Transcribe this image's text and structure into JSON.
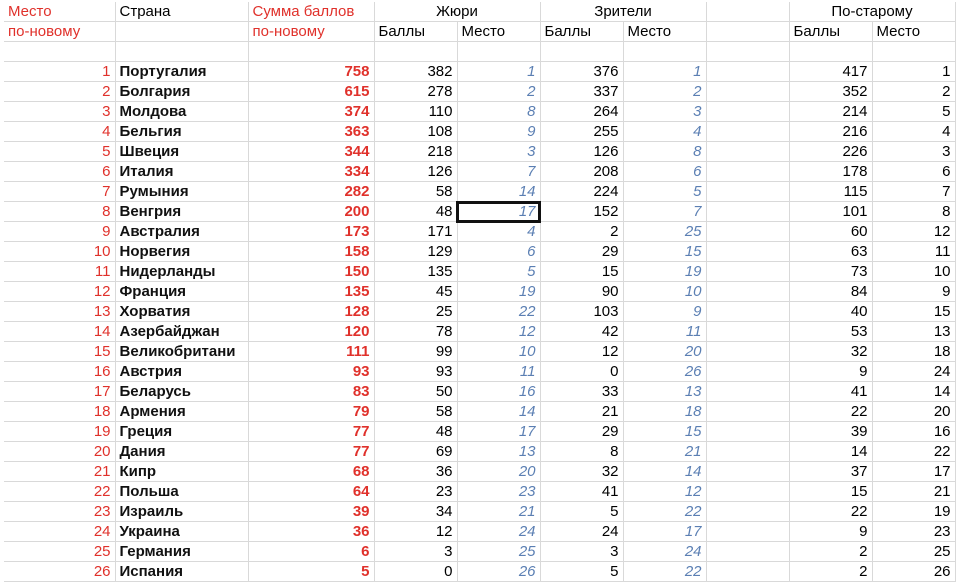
{
  "headers": {
    "row1": {
      "place_new": "Место",
      "country": "Страна",
      "sum": "Сумма баллов",
      "jury": "Жюри",
      "viewers": "Зрители",
      "old": "По-старому"
    },
    "row2": {
      "place_new": "по-новому",
      "sum": "по-новому",
      "jury_points": "Баллы",
      "jury_place": "Место",
      "viewers_points": "Баллы",
      "viewers_place": "Место",
      "old_points": "Баллы",
      "old_place": "Место"
    }
  },
  "rows": [
    {
      "place": "1",
      "country": "Португалия",
      "sum": "758",
      "jury_pts": "382",
      "jury_pl": "1",
      "view_pts": "376",
      "view_pl": "1",
      "old_pts": "417",
      "old_pl": "1"
    },
    {
      "place": "2",
      "country": "Болгария",
      "sum": "615",
      "jury_pts": "278",
      "jury_pl": "2",
      "view_pts": "337",
      "view_pl": "2",
      "old_pts": "352",
      "old_pl": "2"
    },
    {
      "place": "3",
      "country": "Молдова",
      "sum": "374",
      "jury_pts": "110",
      "jury_pl": "8",
      "view_pts": "264",
      "view_pl": "3",
      "old_pts": "214",
      "old_pl": "5"
    },
    {
      "place": "4",
      "country": "Бельгия",
      "sum": "363",
      "jury_pts": "108",
      "jury_pl": "9",
      "view_pts": "255",
      "view_pl": "4",
      "old_pts": "216",
      "old_pl": "4"
    },
    {
      "place": "5",
      "country": "Швеция",
      "sum": "344",
      "jury_pts": "218",
      "jury_pl": "3",
      "view_pts": "126",
      "view_pl": "8",
      "old_pts": "226",
      "old_pl": "3"
    },
    {
      "place": "6",
      "country": "Италия",
      "sum": "334",
      "jury_pts": "126",
      "jury_pl": "7",
      "view_pts": "208",
      "view_pl": "6",
      "old_pts": "178",
      "old_pl": "6"
    },
    {
      "place": "7",
      "country": "Румыния",
      "sum": "282",
      "jury_pts": "58",
      "jury_pl": "14",
      "view_pts": "224",
      "view_pl": "5",
      "old_pts": "115",
      "old_pl": "7"
    },
    {
      "place": "8",
      "country": "Венгрия",
      "sum": "200",
      "jury_pts": "48",
      "jury_pl": "17",
      "view_pts": "152",
      "view_pl": "7",
      "old_pts": "101",
      "old_pl": "8"
    },
    {
      "place": "9",
      "country": "Австралия",
      "sum": "173",
      "jury_pts": "171",
      "jury_pl": "4",
      "view_pts": "2",
      "view_pl": "25",
      "old_pts": "60",
      "old_pl": "12"
    },
    {
      "place": "10",
      "country": "Норвегия",
      "sum": "158",
      "jury_pts": "129",
      "jury_pl": "6",
      "view_pts": "29",
      "view_pl": "15",
      "old_pts": "63",
      "old_pl": "11"
    },
    {
      "place": "11",
      "country": "Нидерланды",
      "sum": "150",
      "jury_pts": "135",
      "jury_pl": "5",
      "view_pts": "15",
      "view_pl": "19",
      "old_pts": "73",
      "old_pl": "10"
    },
    {
      "place": "12",
      "country": "Франция",
      "sum": "135",
      "jury_pts": "45",
      "jury_pl": "19",
      "view_pts": "90",
      "view_pl": "10",
      "old_pts": "84",
      "old_pl": "9"
    },
    {
      "place": "13",
      "country": "Хорватия",
      "sum": "128",
      "jury_pts": "25",
      "jury_pl": "22",
      "view_pts": "103",
      "view_pl": "9",
      "old_pts": "40",
      "old_pl": "15"
    },
    {
      "place": "14",
      "country": "Азербайджан",
      "sum": "120",
      "jury_pts": "78",
      "jury_pl": "12",
      "view_pts": "42",
      "view_pl": "11",
      "old_pts": "53",
      "old_pl": "13"
    },
    {
      "place": "15",
      "country": "Великобритани",
      "sum": "111",
      "jury_pts": "99",
      "jury_pl": "10",
      "view_pts": "12",
      "view_pl": "20",
      "old_pts": "32",
      "old_pl": "18"
    },
    {
      "place": "16",
      "country": "Австрия",
      "sum": "93",
      "jury_pts": "93",
      "jury_pl": "11",
      "view_pts": "0",
      "view_pl": "26",
      "old_pts": "9",
      "old_pl": "24"
    },
    {
      "place": "17",
      "country": "Беларусь",
      "sum": "83",
      "jury_pts": "50",
      "jury_pl": "16",
      "view_pts": "33",
      "view_pl": "13",
      "old_pts": "41",
      "old_pl": "14"
    },
    {
      "place": "18",
      "country": "Армения",
      "sum": "79",
      "jury_pts": "58",
      "jury_pl": "14",
      "view_pts": "21",
      "view_pl": "18",
      "old_pts": "22",
      "old_pl": "20"
    },
    {
      "place": "19",
      "country": "Греция",
      "sum": "77",
      "jury_pts": "48",
      "jury_pl": "17",
      "view_pts": "29",
      "view_pl": "15",
      "old_pts": "39",
      "old_pl": "16"
    },
    {
      "place": "20",
      "country": "Дания",
      "sum": "77",
      "jury_pts": "69",
      "jury_pl": "13",
      "view_pts": "8",
      "view_pl": "21",
      "old_pts": "14",
      "old_pl": "22"
    },
    {
      "place": "21",
      "country": "Кипр",
      "sum": "68",
      "jury_pts": "36",
      "jury_pl": "20",
      "view_pts": "32",
      "view_pl": "14",
      "old_pts": "37",
      "old_pl": "17"
    },
    {
      "place": "22",
      "country": "Польша",
      "sum": "64",
      "jury_pts": "23",
      "jury_pl": "23",
      "view_pts": "41",
      "view_pl": "12",
      "old_pts": "15",
      "old_pl": "21"
    },
    {
      "place": "23",
      "country": "Израиль",
      "sum": "39",
      "jury_pts": "34",
      "jury_pl": "21",
      "view_pts": "5",
      "view_pl": "22",
      "old_pts": "22",
      "old_pl": "19"
    },
    {
      "place": "24",
      "country": "Украина",
      "sum": "36",
      "jury_pts": "12",
      "jury_pl": "24",
      "view_pts": "24",
      "view_pl": "17",
      "old_pts": "9",
      "old_pl": "23"
    },
    {
      "place": "25",
      "country": "Германия",
      "sum": "6",
      "jury_pts": "3",
      "jury_pl": "25",
      "view_pts": "3",
      "view_pl": "24",
      "old_pts": "2",
      "old_pl": "25"
    },
    {
      "place": "26",
      "country": "Испания",
      "sum": "5",
      "jury_pts": "0",
      "jury_pl": "26",
      "view_pts": "5",
      "view_pl": "22",
      "old_pts": "2",
      "old_pl": "26"
    }
  ],
  "selected_cell": {
    "row": 8,
    "column": "jury_pl"
  },
  "colors": {
    "header_red": "#e0312b",
    "place_blue": "#5b7fb3",
    "gridline": "#d9d9d9"
  }
}
